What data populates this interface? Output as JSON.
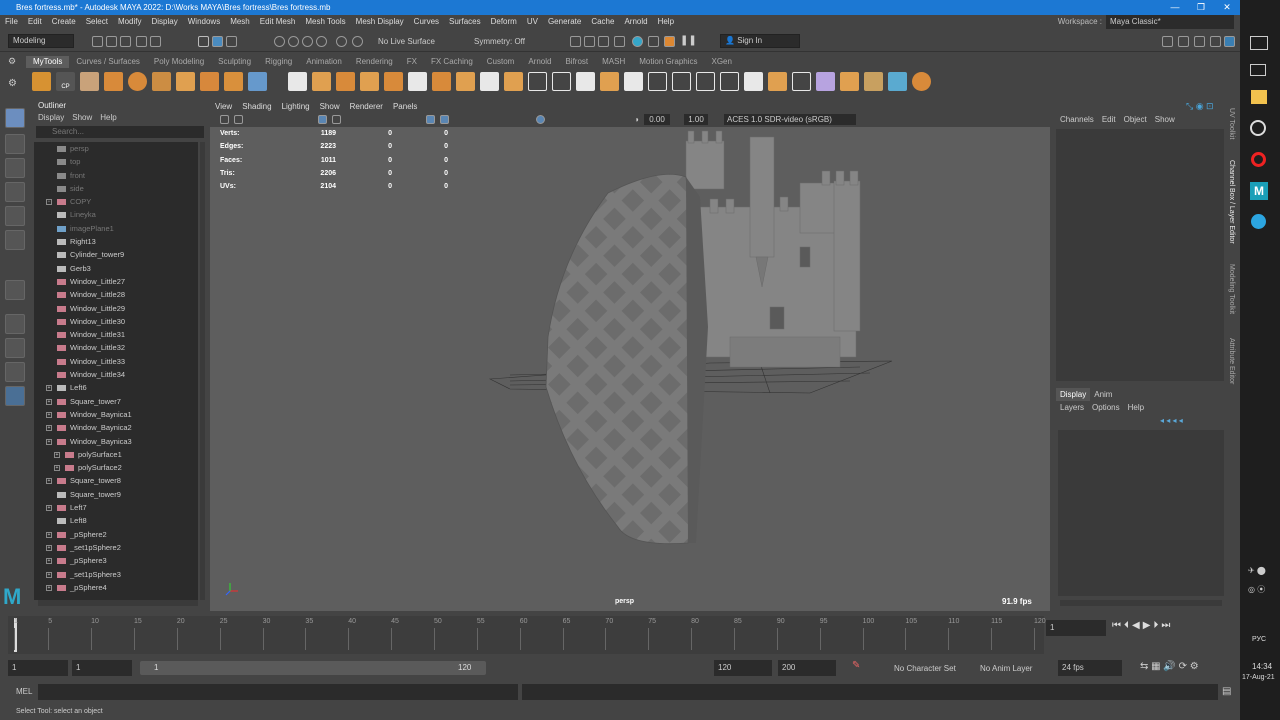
{
  "window": {
    "title": "Bres fortress.mb* - Autodesk MAYA 2022: D:\\Works MAYA\\Bres fortress\\Bres fortress.mb"
  },
  "menubar": [
    "File",
    "Edit",
    "Create",
    "Select",
    "Modify",
    "Display",
    "Windows",
    "Mesh",
    "Edit Mesh",
    "Mesh Tools",
    "Mesh Display",
    "Curves",
    "Surfaces",
    "Deform",
    "UV",
    "Generate",
    "Cache",
    "Arnold",
    "Help"
  ],
  "workspace": {
    "label": "Workspace :",
    "value": "Maya Classic*"
  },
  "statusline": {
    "mode": "Modeling",
    "live_surface": "No Live Surface",
    "symmetry": "Symmetry: Off",
    "sign_in": "Sign In"
  },
  "shelf_tabs": [
    "MyTools",
    "Curves / Surfaces",
    "Poly Modeling",
    "Sculpting",
    "Rigging",
    "Animation",
    "Rendering",
    "FX",
    "FX Caching",
    "Custom",
    "Arnold",
    "Bifrost",
    "MASH",
    "Motion Graphics",
    "XGen"
  ],
  "shelf_cp": "CP",
  "outliner": {
    "title": "Outliner",
    "menu": [
      "Display",
      "Show",
      "Help"
    ],
    "search_placeholder": "Search...",
    "items": [
      {
        "label": "persp",
        "type": "camera",
        "dim": true,
        "expand": false
      },
      {
        "label": "top",
        "type": "camera",
        "dim": true,
        "expand": false
      },
      {
        "label": "front",
        "type": "camera",
        "dim": true,
        "expand": false
      },
      {
        "label": "side",
        "type": "camera",
        "dim": true,
        "expand": false
      },
      {
        "label": "COPY",
        "type": "mesh",
        "dim": true,
        "expand": true
      },
      {
        "label": "Lineyka",
        "type": "group",
        "dim": true,
        "expand": false
      },
      {
        "label": "imagePlane1",
        "type": "image",
        "dim": true,
        "expand": false
      },
      {
        "label": "Right13",
        "type": "group",
        "dim": false,
        "expand": false
      },
      {
        "label": "Cylinder_tower9",
        "type": "group",
        "dim": false,
        "expand": false
      },
      {
        "label": "Gerb3",
        "type": "group",
        "dim": false,
        "expand": false
      },
      {
        "label": "Window_Little27",
        "type": "mesh",
        "dim": false,
        "expand": false
      },
      {
        "label": "Window_Little28",
        "type": "mesh",
        "dim": false,
        "expand": false
      },
      {
        "label": "Window_Little29",
        "type": "mesh",
        "dim": false,
        "expand": false
      },
      {
        "label": "Window_Little30",
        "type": "mesh",
        "dim": false,
        "expand": false
      },
      {
        "label": "Window_Little31",
        "type": "mesh",
        "dim": false,
        "expand": false
      },
      {
        "label": "Window_Little32",
        "type": "mesh",
        "dim": false,
        "expand": false
      },
      {
        "label": "Window_Little33",
        "type": "mesh",
        "dim": false,
        "expand": false
      },
      {
        "label": "Window_Little34",
        "type": "mesh",
        "dim": false,
        "expand": false
      },
      {
        "label": "Left6",
        "type": "group",
        "dim": false,
        "expand": true
      },
      {
        "label": "Square_tower7",
        "type": "mesh",
        "dim": false,
        "expand": true
      },
      {
        "label": "Window_Baynica1",
        "type": "mesh",
        "dim": false,
        "expand": true
      },
      {
        "label": "Window_Baynica2",
        "type": "mesh",
        "dim": false,
        "expand": true
      },
      {
        "label": "Window_Baynica3",
        "type": "mesh",
        "dim": false,
        "expand": true
      },
      {
        "label": "polySurface1",
        "type": "mesh",
        "dim": false,
        "expand": true,
        "indent": true
      },
      {
        "label": "polySurface2",
        "type": "mesh",
        "dim": false,
        "expand": true,
        "indent": true
      },
      {
        "label": "Square_tower8",
        "type": "mesh",
        "dim": false,
        "expand": true
      },
      {
        "label": "Square_tower9",
        "type": "group",
        "dim": false,
        "expand": false
      },
      {
        "label": "Left7",
        "type": "mesh",
        "dim": false,
        "expand": true
      },
      {
        "label": "Left8",
        "type": "group",
        "dim": false,
        "expand": false
      },
      {
        "label": "_pSphere2",
        "type": "mesh",
        "dim": false,
        "expand": true
      },
      {
        "label": "_set1pSphere2",
        "type": "mesh",
        "dim": false,
        "expand": true
      },
      {
        "label": "_pSphere3",
        "type": "mesh",
        "dim": false,
        "expand": true
      },
      {
        "label": "_set1pSphere3",
        "type": "mesh",
        "dim": false,
        "expand": true
      },
      {
        "label": "_pSphere4",
        "type": "mesh",
        "dim": false,
        "expand": true
      }
    ]
  },
  "viewport": {
    "menu": [
      "View",
      "Shading",
      "Lighting",
      "Show",
      "Renderer",
      "Panels"
    ],
    "exposure": "0.00",
    "gamma": "1.00",
    "colorspace": "ACES 1.0 SDR-video (sRGB)",
    "camera": "persp",
    "fps": "91.9 fps",
    "hud": [
      {
        "label": "Verts:",
        "a": "1189",
        "b": "0",
        "c": "0"
      },
      {
        "label": "Edges:",
        "a": "2223",
        "b": "0",
        "c": "0"
      },
      {
        "label": "Faces:",
        "a": "1011",
        "b": "0",
        "c": "0"
      },
      {
        "label": "Tris:",
        "a": "2206",
        "b": "0",
        "c": "0"
      },
      {
        "label": "UVs:",
        "a": "2104",
        "b": "0",
        "c": "0"
      }
    ]
  },
  "channelbox": {
    "menu": [
      "Channels",
      "Edit",
      "Object",
      "Show"
    ]
  },
  "layers": {
    "tabs": [
      "Display",
      "Anim"
    ],
    "menu": [
      "Layers",
      "Options",
      "Help"
    ]
  },
  "side_tabs": [
    "UV Toolkit",
    "Channel Box / Layer Editor",
    "Modeling Toolkit",
    "Attribute Editor"
  ],
  "timeline": {
    "ticks": [
      "1",
      "5",
      "10",
      "15",
      "20",
      "25",
      "30",
      "35",
      "40",
      "45",
      "50",
      "55",
      "60",
      "65",
      "70",
      "75",
      "80",
      "85",
      "90",
      "95",
      "100",
      "105",
      "110",
      "115",
      "120"
    ],
    "current_frame": "1"
  },
  "range": {
    "start": "1",
    "playback_start": "1",
    "slider_start": "1",
    "slider_end": "120",
    "playback_end": "120",
    "end": "200",
    "char_set": "No Character Set",
    "anim_layer": "No Anim Layer",
    "fps": "24 fps"
  },
  "cmdline": {
    "lang": "MEL"
  },
  "helpline": "Select Tool: select an object",
  "taskbar": {
    "lang": "РУС",
    "time": "14:34",
    "date": "17-Aug-21"
  }
}
